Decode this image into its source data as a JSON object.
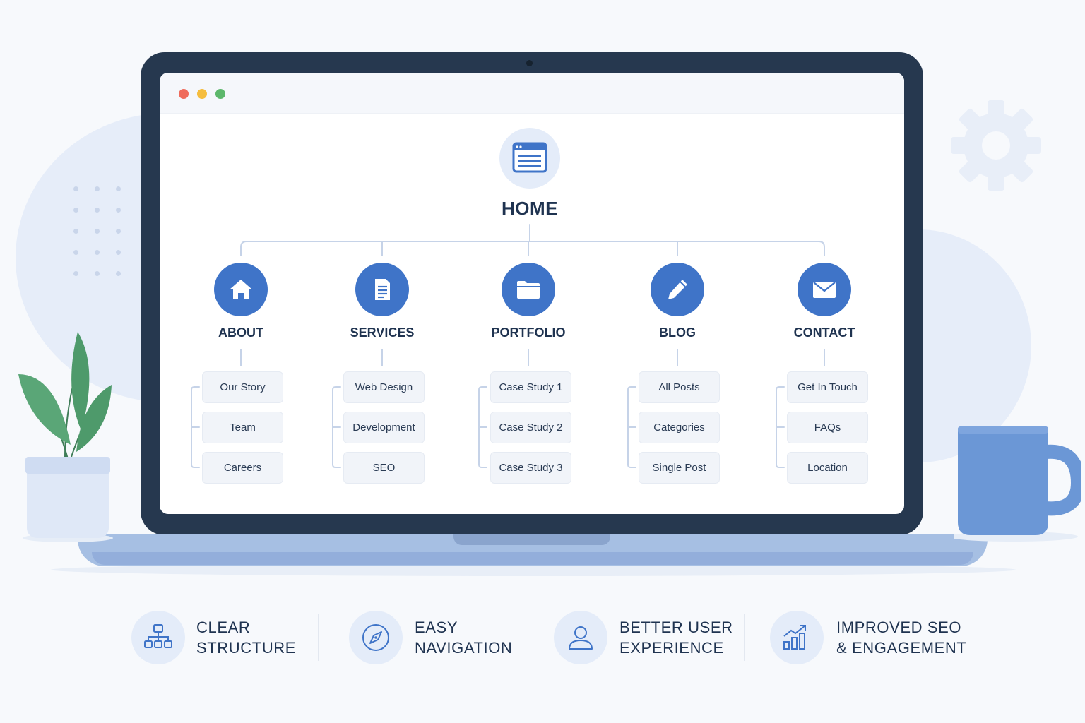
{
  "sitemap": {
    "root": {
      "label": "HOME",
      "icon": "browser-window-icon"
    },
    "categories": [
      {
        "label": "ABOUT",
        "icon": "house-icon",
        "items": [
          "Our Story",
          "Team",
          "Careers"
        ]
      },
      {
        "label": "SERVICES",
        "icon": "document-icon",
        "items": [
          "Web Design",
          "Development",
          "SEO"
        ]
      },
      {
        "label": "PORTFOLIO",
        "icon": "folder-icon",
        "items": [
          "Case Study 1",
          "Case Study 2",
          "Case Study 3"
        ]
      },
      {
        "label": "BLOG",
        "icon": "pencil-icon",
        "items": [
          "All Posts",
          "Categories",
          "Single Post"
        ]
      },
      {
        "label": "CONTACT",
        "icon": "envelope-icon",
        "items": [
          "Get In Touch",
          "FAQs",
          "Location"
        ]
      }
    ]
  },
  "features": [
    {
      "icon": "hierarchy-icon",
      "line1": "CLEAR",
      "line2": "STRUCTURE"
    },
    {
      "icon": "compass-icon",
      "line1": "EASY",
      "line2": "NAVIGATION"
    },
    {
      "icon": "user-icon",
      "line1": "BETTER USER",
      "line2": "EXPERIENCE"
    },
    {
      "icon": "growth-chart-icon",
      "line1": "IMPROVED SEO",
      "line2": "& ENGAGEMENT"
    }
  ],
  "colors": {
    "accent": "#3f74c8",
    "laptop_frame": "#26384f",
    "laptop_base": "#a6bfe3",
    "text_dark": "#1f3350",
    "plant": "#4e9a6b",
    "mug": "#6b97d6"
  }
}
